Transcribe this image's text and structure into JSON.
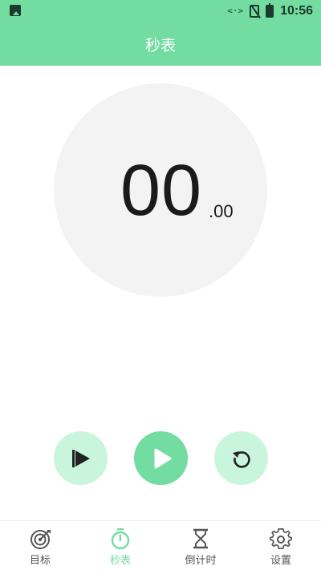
{
  "status_bar": {
    "time": "10:56",
    "icons": [
      "image-icon",
      "data-sync-icon",
      "no-sim-icon",
      "battery-icon"
    ],
    "data_glyph": "<·>"
  },
  "header": {
    "title": "秒表"
  },
  "stopwatch": {
    "seconds": "00",
    "fraction": ".00"
  },
  "controls": {
    "icons": [
      "lap-flag-icon",
      "play-icon",
      "reset-icon"
    ]
  },
  "tabs": [
    {
      "label": "目标",
      "icon": "target-icon",
      "active": false
    },
    {
      "label": "秒表",
      "icon": "stopwatch-icon",
      "active": true
    },
    {
      "label": "倒计时",
      "icon": "hourglass-icon",
      "active": false
    },
    {
      "label": "设置",
      "icon": "gear-icon",
      "active": false
    }
  ],
  "colors": {
    "accent": "#72dca1",
    "accent_light": "#c8f5dc",
    "circle_bg": "#f3f3f3",
    "text": "#1a1a1a",
    "tab_inactive": "#555555"
  }
}
